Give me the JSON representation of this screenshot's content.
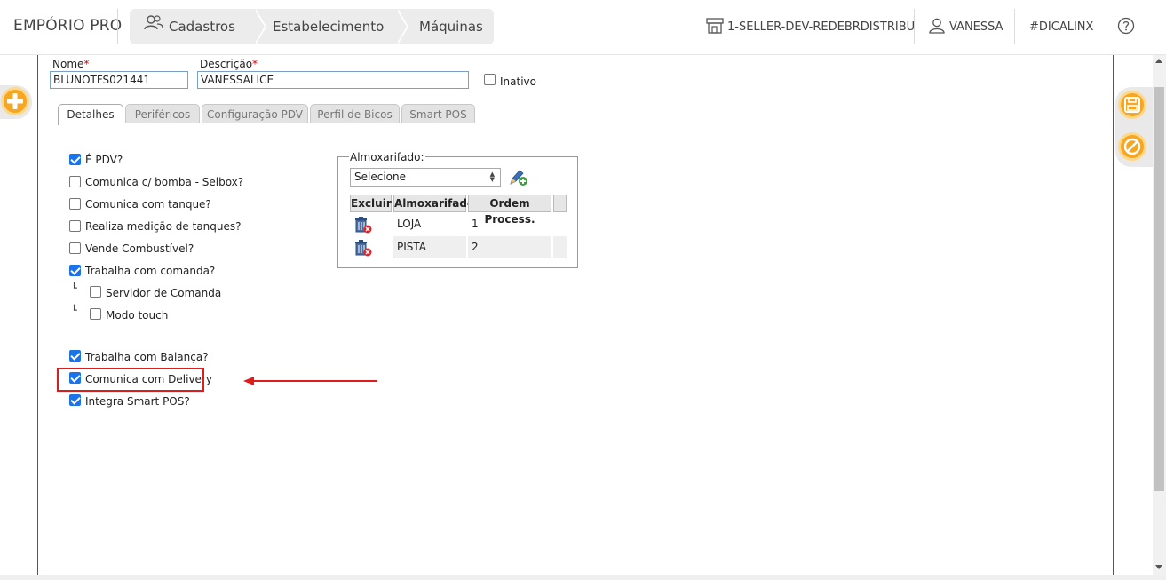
{
  "header": {
    "brand": "EMPÓRIO PRO",
    "breadcrumbs": [
      {
        "label": "Cadastros",
        "icon": "users-icon"
      },
      {
        "label": "Estabelecimento"
      },
      {
        "label": "Máquinas"
      }
    ],
    "store": "1-SELLER-DEV-REDEBRDISTRIBU",
    "user": "VANESSA",
    "tag": "#DICALINX"
  },
  "form": {
    "nome_label": "Nome",
    "nome_value": "BLUNOTFS021441",
    "descricao_label": "Descrição",
    "descricao_value": "VANESSALICE",
    "required_mark": "*",
    "inativo_label": "Inativo"
  },
  "tabs": [
    "Detalhes",
    "Periféricos",
    "Configuração PDV",
    "Perfil de Bicos",
    "Smart POS"
  ],
  "active_tab": "Detalhes",
  "checks": [
    {
      "label": "É PDV?",
      "checked": true
    },
    {
      "label": "Comunica c/ bomba - Selbox?",
      "checked": false
    },
    {
      "label": "Comunica com tanque?",
      "checked": false
    },
    {
      "label": "Realiza medição de tanques?",
      "checked": false
    },
    {
      "label": "Vende Combustível?",
      "checked": false
    },
    {
      "label": "Trabalha com comanda?",
      "checked": true
    },
    {
      "label": "Servidor de Comanda",
      "checked": false
    },
    {
      "label": "Modo touch",
      "checked": false
    },
    {
      "label": "Trabalha com Balança?",
      "checked": true
    },
    {
      "label": "Comunica com Delivery",
      "checked": true
    },
    {
      "label": "Integra Smart POS?",
      "checked": true
    }
  ],
  "tree_glyph": "└",
  "almoxarifado": {
    "legend": "Almoxarifado:",
    "select_value": "Selecione",
    "columns": [
      "Excluir",
      "Almoxarifado",
      "Ordem Process."
    ],
    "rows": [
      {
        "almoxarifado": "LOJA",
        "ordem": "1"
      },
      {
        "almoxarifado": "PISTA",
        "ordem": "2"
      }
    ]
  },
  "colors": {
    "accent_orange": "#f5a623",
    "checkbox_blue": "#1a73e8",
    "annotation_red": "#e01b1b"
  }
}
